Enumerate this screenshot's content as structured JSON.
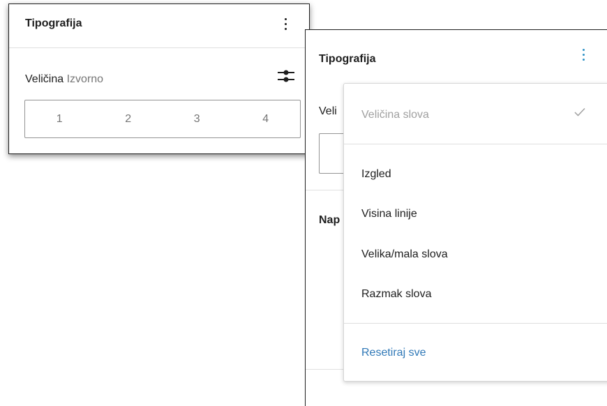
{
  "left_panel": {
    "title": "Tipografija",
    "size_label": "Veličina",
    "size_value": "Izvorno",
    "options": [
      "1",
      "2",
      "3",
      "4"
    ]
  },
  "right_panel": {
    "title": "Tipografija",
    "size_label_cut": "Veli",
    "section_cut": "Nap"
  },
  "menu": {
    "font_size_item": "Veličina slova",
    "items": [
      "Izgled",
      "Visina linije",
      "Velika/mala slova",
      "Razmak slova"
    ],
    "reset": "Resetiraj sve"
  },
  "colors": {
    "accent": "#2f78b7",
    "text": "#1e1e1e",
    "muted": "#757575"
  }
}
